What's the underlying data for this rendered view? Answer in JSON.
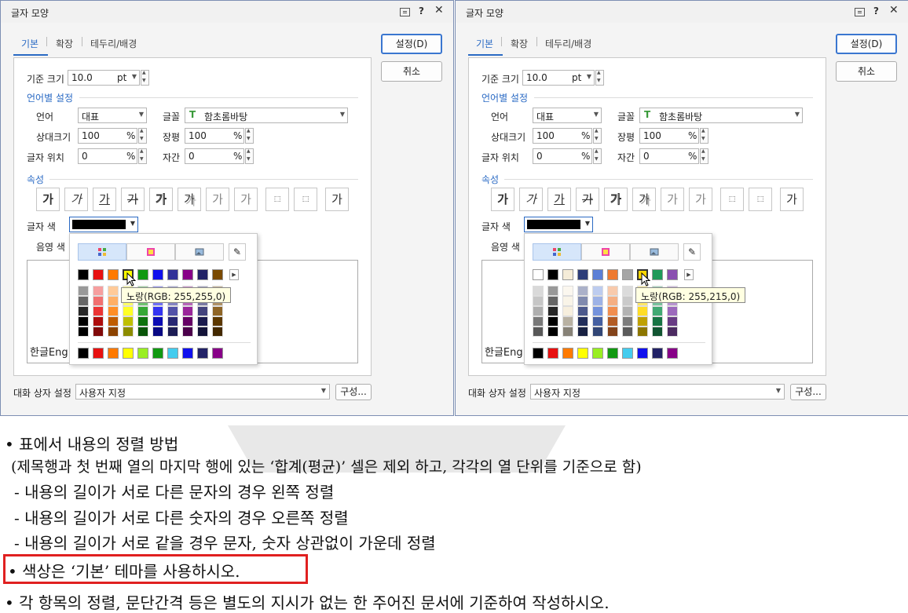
{
  "dialogs": [
    {
      "title": "글자 모양",
      "tabs": [
        "기본",
        "확장",
        "테두리/배경"
      ],
      "ok_label": "설정(D)",
      "cancel_label": "취소",
      "base_size_label": "기준 크기",
      "base_size_value": "10.0",
      "base_size_unit": "pt",
      "lang_section": "언어별 설정",
      "lang_label": "언어",
      "lang_value": "대표",
      "font_label": "글꼴",
      "font_value": "함초롬바탕",
      "rel_size_label": "상대크기",
      "rel_size_value": "100",
      "width_label": "장평",
      "width_value": "100",
      "pos_label": "글자 위치",
      "pos_value": "0",
      "spacing_label": "자간",
      "spacing_value": "0",
      "percent": "%",
      "attr_section": "속성",
      "attr_glyph": "가",
      "color_label": "글자 색",
      "shade_label": "음영 색",
      "preview_text": "한글Eng",
      "tooltip": "노랑(RGB: 255,255,0)",
      "bottom_label": "대화 상자 설정",
      "bottom_value": "사용자 지정",
      "config_label": "구성...",
      "swatch_top": [
        "#000000",
        "#e81010",
        "#ff7a00",
        "#ffff00",
        "#119911",
        "#1010ee",
        "#333399",
        "#880088",
        "#222266",
        "#7a4a00"
      ],
      "swatch_bottom": [
        "#000000",
        "#e81010",
        "#ff7a00",
        "#ffff00",
        "#99ee22",
        "#119911",
        "#44ccee",
        "#1010ee",
        "#222266",
        "#880088"
      ],
      "hover_swatch": 3
    },
    {
      "title": "글자 모양",
      "tabs": [
        "기본",
        "확장",
        "테두리/배경"
      ],
      "ok_label": "설정(D)",
      "cancel_label": "취소",
      "base_size_label": "기준 크기",
      "base_size_value": "10.0",
      "base_size_unit": "pt",
      "lang_section": "언어별 설정",
      "lang_label": "언어",
      "lang_value": "대표",
      "font_label": "글꼴",
      "font_value": "함초롬바탕",
      "rel_size_label": "상대크기",
      "rel_size_value": "100",
      "width_label": "장평",
      "width_value": "100",
      "pos_label": "글자 위치",
      "pos_value": "0",
      "spacing_label": "자간",
      "spacing_value": "0",
      "percent": "%",
      "attr_section": "속성",
      "attr_glyph": "가",
      "color_label": "글자 색",
      "shade_label": "음영 색",
      "preview_text": "한글Eng",
      "tooltip": "노랑(RGB: 255,215,0)",
      "bottom_label": "대화 상자 설정",
      "bottom_value": "사용자 지정",
      "config_label": "구성...",
      "swatch_top": [
        "#ffffff",
        "#000000",
        "#f5ecd8",
        "#2c3c78",
        "#5b7fd6",
        "#ee7a30",
        "#a6a6a6",
        "#ffd700",
        "#1f9a5a",
        "#8a4fb0"
      ],
      "swatch_bottom": [
        "#000000",
        "#e81010",
        "#ff7a00",
        "#ffff00",
        "#99ee22",
        "#119911",
        "#44ccee",
        "#1010ee",
        "#222266",
        "#880088"
      ],
      "hover_swatch": 7
    }
  ],
  "document": {
    "line1": "• 표에서 내용의 정렬 방법",
    "line2": "(제목행과 첫 번째 열의 마지막 행에 있는 ‘합계(평균)’ 셀은 제외 하고, 각각의 열 단위를 기준으로 함)",
    "line3": "- 내용의 길이가 서로 다른 문자의 경우 왼쪽 정렬",
    "line4": "- 내용의 길이가 서로 다른 숫자의 경우 오른쪽 정렬",
    "line5": "- 내용의 길이가 서로 같을 경우 문자, 숫자 상관없이 가운데 정렬",
    "line6": "• 색상은 ‘기본’ 테마를 사용하시오.",
    "line7": "• 각 항목의 정렬, 문단간격 등은 별도의 지시가 없는 한 주어진 문서에 기준하여 작성하시오."
  }
}
